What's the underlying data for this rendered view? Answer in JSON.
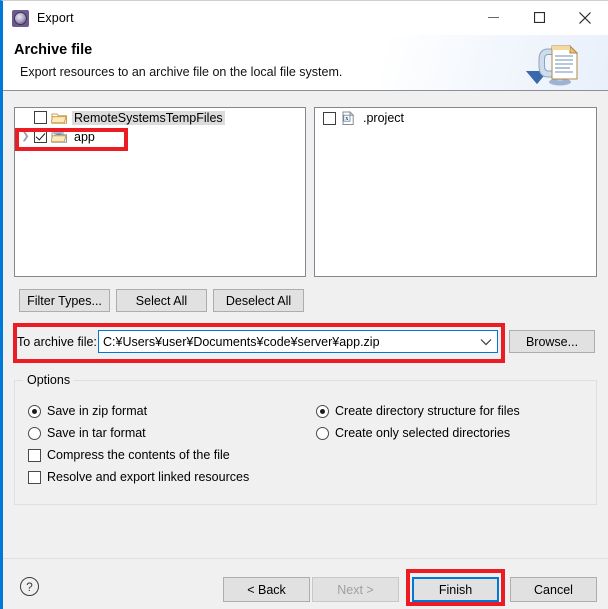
{
  "window": {
    "title": "Export",
    "icon": "export-wizard-gear-icon",
    "controls": {
      "minimize": "minimize-icon",
      "maximize": "maximize-icon",
      "close": "close-icon"
    }
  },
  "header": {
    "title": "Archive file",
    "description": "Export resources to an archive file on the local file system.",
    "graphic": "export-archive-banner-icon"
  },
  "tree_left": {
    "rows": [
      {
        "label": "RemoteSystemsTempFiles",
        "checked": false,
        "expandable": false,
        "selected": true,
        "icon": "folder-icon"
      },
      {
        "label": "app",
        "checked": true,
        "expandable": true,
        "selected": false,
        "icon": "open-folder-icon"
      }
    ]
  },
  "tree_right": {
    "rows": [
      {
        "label": ".project",
        "checked": false,
        "icon": "xml-file-icon"
      }
    ]
  },
  "tree_buttons": {
    "filter_types": "Filter Types...",
    "select_all": "Select All",
    "deselect_all": "Deselect All"
  },
  "archive": {
    "label": "To archive file:",
    "value": "C:¥Users¥user¥Documents¥code¥server¥app.zip",
    "placeholder": "",
    "dropdown_icon": "chevron-down-icon",
    "browse_button": "Browse..."
  },
  "options": {
    "legend": "Options",
    "left_column": [
      {
        "type": "radio",
        "label": "Save in zip format",
        "checked": true
      },
      {
        "type": "radio",
        "label": "Save in tar format",
        "checked": false
      },
      {
        "type": "checkbox",
        "label": "Compress the contents of the file",
        "checked": false
      },
      {
        "type": "checkbox",
        "label": "Resolve and export linked resources",
        "checked": false
      }
    ],
    "right_column": [
      {
        "type": "radio",
        "label": "Create directory structure for files",
        "checked": true
      },
      {
        "type": "radio",
        "label": "Create only selected directories",
        "checked": false
      }
    ]
  },
  "footer": {
    "help_icon": "help-question-icon",
    "back": "< Back",
    "next": "Next >",
    "finish": "Finish",
    "cancel": "Cancel",
    "next_disabled": true,
    "finish_focused": true
  },
  "annotations": {
    "color": "#ec1c24",
    "boxes": [
      "app-tree-row",
      "to-archive-file-field",
      "finish-button"
    ]
  },
  "colors": {
    "accent": "#0078d7",
    "dialog_bg": "#f0f0f0",
    "annotation_red": "#ec1c24",
    "button_bg": "#e1e1e1"
  }
}
